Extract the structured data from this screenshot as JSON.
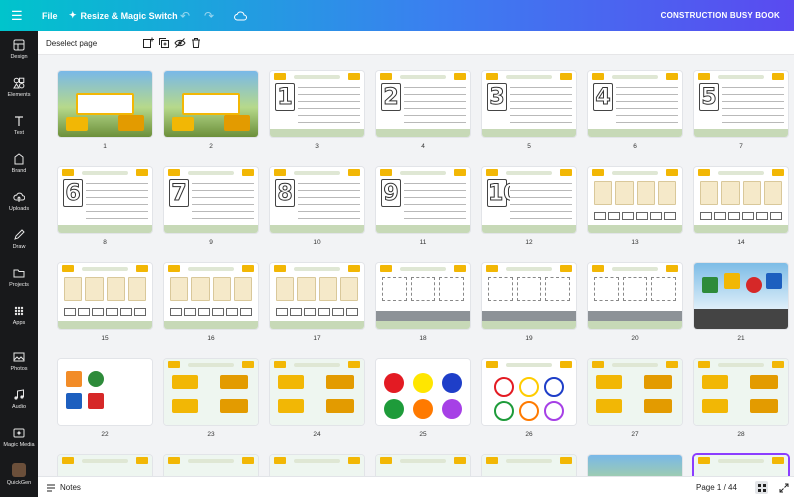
{
  "topbar": {
    "file_label": "File",
    "resize_label": "Resize & Magic Switch",
    "doc_title": "CONSTRUCTION BUSY BOOK"
  },
  "sidebar": {
    "items": [
      {
        "label": "Design",
        "icon": "design-icon"
      },
      {
        "label": "Elements",
        "icon": "elements-icon"
      },
      {
        "label": "Text",
        "icon": "text-icon"
      },
      {
        "label": "Brand",
        "icon": "brand-icon"
      },
      {
        "label": "Uploads",
        "icon": "uploads-icon"
      },
      {
        "label": "Draw",
        "icon": "draw-icon"
      },
      {
        "label": "Projects",
        "icon": "projects-icon"
      },
      {
        "label": "Apps",
        "icon": "apps-icon"
      },
      {
        "label": "Photos",
        "icon": "photos-icon"
      },
      {
        "label": "Audio",
        "icon": "audio-icon"
      },
      {
        "label": "Magic Media",
        "icon": "magic-media-icon"
      },
      {
        "label": "QuickGen",
        "icon": "quickgen-avatar"
      }
    ]
  },
  "pagebar": {
    "deselect_label": "Deselect page"
  },
  "pages": [
    {
      "num": "1",
      "kind": "cover"
    },
    {
      "num": "2",
      "kind": "cover"
    },
    {
      "num": "3",
      "kind": "trace",
      "digit": "1"
    },
    {
      "num": "4",
      "kind": "trace",
      "digit": "2"
    },
    {
      "num": "5",
      "kind": "trace",
      "digit": "3"
    },
    {
      "num": "6",
      "kind": "trace",
      "digit": "4"
    },
    {
      "num": "7",
      "kind": "trace",
      "digit": "5"
    },
    {
      "num": "8",
      "kind": "trace",
      "digit": "6"
    },
    {
      "num": "9",
      "kind": "trace",
      "digit": "7"
    },
    {
      "num": "10",
      "kind": "trace",
      "digit": "8"
    },
    {
      "num": "11",
      "kind": "trace",
      "digit": "9"
    },
    {
      "num": "12",
      "kind": "trace",
      "digit": "10"
    },
    {
      "num": "13",
      "kind": "count"
    },
    {
      "num": "14",
      "kind": "count"
    },
    {
      "num": "15",
      "kind": "count"
    },
    {
      "num": "16",
      "kind": "count"
    },
    {
      "num": "17",
      "kind": "count"
    },
    {
      "num": "18",
      "kind": "shapes"
    },
    {
      "num": "19",
      "kind": "shapes"
    },
    {
      "num": "20",
      "kind": "shapes"
    },
    {
      "num": "21",
      "kind": "traffic"
    },
    {
      "num": "22",
      "kind": "signs"
    },
    {
      "num": "23",
      "kind": "match"
    },
    {
      "num": "24",
      "kind": "match"
    },
    {
      "num": "25",
      "kind": "colors"
    },
    {
      "num": "26",
      "kind": "colors2"
    },
    {
      "num": "27",
      "kind": "match"
    },
    {
      "num": "28",
      "kind": "match"
    },
    {
      "num": "",
      "kind": "pale"
    },
    {
      "num": "",
      "kind": "pale"
    },
    {
      "num": "",
      "kind": "pale"
    },
    {
      "num": "",
      "kind": "pale"
    },
    {
      "num": "",
      "kind": "pale"
    },
    {
      "num": "",
      "kind": "cover"
    },
    {
      "num": "",
      "kind": "pale",
      "selected": true
    }
  ],
  "bottombar": {
    "notes_label": "Notes",
    "page_indicator": "Page 1 / 44"
  },
  "colors": {
    "accent": "#8b3dff",
    "sidebar_bg": "#18191b"
  }
}
